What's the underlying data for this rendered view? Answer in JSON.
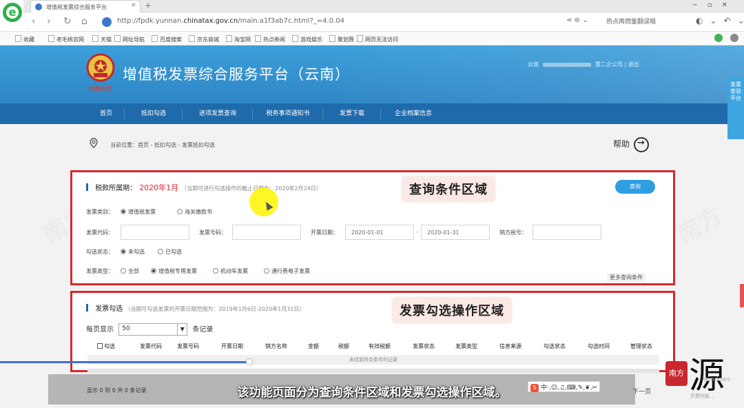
{
  "browser": {
    "tab_title": "增值税发票综合服务平台",
    "url_prefix": "http://",
    "url_domain_a": "fpdk.yunnan.",
    "url_domain_b": "chinatax.gov.cn",
    "url_path": "/main.a1f3ab7c.html?_=4.0.04",
    "addr_right": "热点再燃董翻误唱",
    "bookmarks": [
      "收藏",
      "老毛桃官网",
      "天猫",
      "网址导航",
      "百度搜索",
      "京东商城",
      "淘宝网",
      "热点新闻",
      "游戏娱乐",
      "聚划算",
      "网页无法访问"
    ]
  },
  "header": {
    "title": "增值税发票综合服务平台（云南）",
    "emblem_caption": "中国税务",
    "user_left": "云南",
    "user_mid": "置二企公司",
    "user_right": "退出"
  },
  "nav": {
    "items": [
      "首页",
      "抵扣勾选",
      "进项发票查询",
      "税务事项通知书",
      "发票下载",
      "企业档案信息"
    ]
  },
  "side_tab": {
    "label": "发票查验平台"
  },
  "breadcrumb": {
    "text": "当前位置：首页 - 抵扣勾选 - 发票抵扣勾选",
    "help": "帮助"
  },
  "query": {
    "overlay": "查询条件区域",
    "title_label": "税款所属期：",
    "period": "2020年1月",
    "hint": "（当期可进行勾选操作的截止日期为：2020年2月24日）",
    "query_button": "查询",
    "category_label": "发票类别：",
    "category_options": [
      "增值税发票",
      "海关缴款书"
    ],
    "code_label": "发票代码：",
    "number_label": "发票号码：",
    "date_label": "开票日期：",
    "date_from": "2020-01-01",
    "date_sep": "-",
    "date_to": "2020-01-31",
    "seller_tax_label": "销方税号：",
    "status_label": "勾选状态：",
    "status_options": [
      "未勾选",
      "已勾选"
    ],
    "type_label": "发票类型：",
    "type_options": [
      "全部",
      "增值税专用发票",
      "机动车发票",
      "通行费电子发票"
    ],
    "more": "更多查询条件"
  },
  "invoice": {
    "overlay": "发票勾选操作区域",
    "title": "发票勾选",
    "hint": "（当期可勾选发票的开票日期范围为：2019年1月6日-2020年1月31日）",
    "per_page_label": "每页显示",
    "per_page_value": "50",
    "per_page_suffix": "条记录",
    "columns": [
      "勾选",
      "发票代码",
      "发票号码",
      "开票日期",
      "销方名称",
      "金额",
      "税额",
      "有效税额",
      "发票状态",
      "发票类型",
      "信息来源",
      "勾选状态",
      "勾选时间",
      "管理状态"
    ],
    "empty": "未找到符合条件的记录"
  },
  "footer": {
    "count_text": "显示 0 到 0 共 0 条记录",
    "next": "下一页"
  },
  "video": {
    "subtitle": "该功能页面分为查询条件区域和发票勾选操作区域。",
    "progress": 0.335,
    "ime_text": "中·,☺,♫,⌨,✎,❦,✂",
    "ime_brand": "S",
    "seal_text": "南方",
    "wm_glyph": "源",
    "wm_sub": "开票代账...",
    "wm_win": "Windows"
  },
  "colors": {
    "header_blue": "#2e86c6",
    "nav_blue": "#1f6aab",
    "highlight_red": "#d9262c",
    "query_btn": "#2e9ee2"
  }
}
